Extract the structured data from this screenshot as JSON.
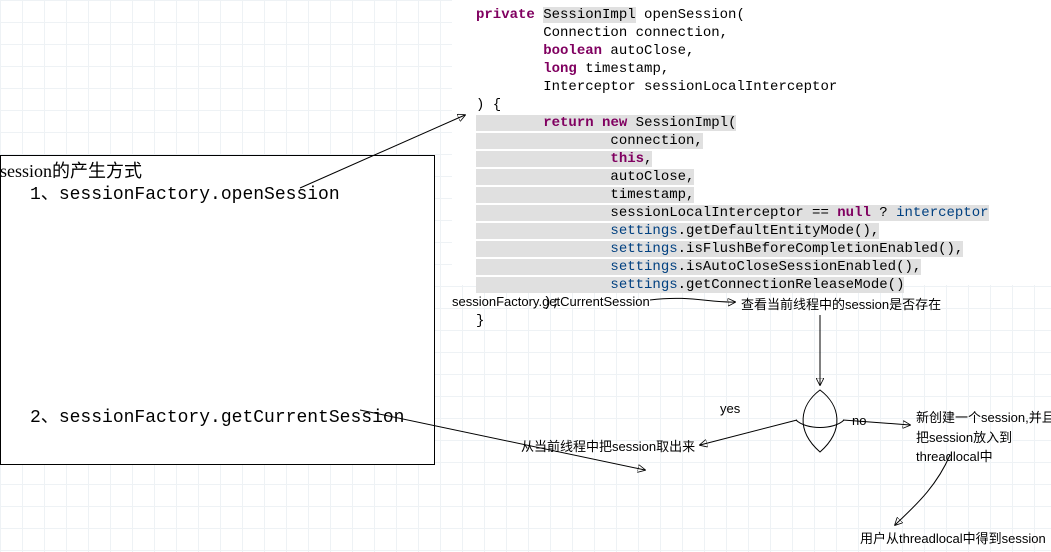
{
  "left_box": {
    "title": "session的产生方式",
    "item1_prefix": "1、",
    "item1_code": "sessionFactory.openSession",
    "item2_prefix": "2、",
    "item2_code": "sessionFactory.getCurrentSession"
  },
  "code": {
    "l1_kw1": "private",
    "l1_type": "SessionImpl",
    "l1_name": " openSession(",
    "l2": "        Connection connection,",
    "l3_kw": "boolean",
    "l3_rest": " autoClose,",
    "l4_kw": "long",
    "l4_rest": " timestamp,",
    "l5": "        Interceptor sessionLocalInterceptor",
    "l6": ") {",
    "l7_kw1": "return",
    "l7_kw2": "new",
    "l7_rest": " SessionImpl(",
    "l8": "                connection,",
    "l9_kw": "this",
    "l9_rest": ",",
    "l10": "                autoClose,",
    "l11": "                timestamp,",
    "l12a": "                sessionLocalInterceptor == ",
    "l12_kw": "null",
    "l12b": " ? ",
    "l12_id": "interceptor",
    "l13_id": "settings",
    "l13_rest": ".getDefaultEntityMode(),",
    "l14_id": "settings",
    "l14_rest": ".isFlushBeforeCompletionEnabled(),",
    "l15_id": "settings",
    "l15_rest": ".isAutoCloseSessionEnabled(),",
    "l16_id": "settings",
    "l16_rest": ".getConnectionReleaseMode()",
    "l17": "        );",
    "l18": "}"
  },
  "diagram": {
    "caption": "sessionFactory.getCurrentSession",
    "check": "查看当前线程中的session是否存在",
    "yes": "yes",
    "no": "no",
    "from_thread": "从当前线程中把session取出来",
    "new_session": "新创建一个session,并且把session放入到threadlocal中",
    "get_session": "用户从threadlocal中得到session"
  }
}
